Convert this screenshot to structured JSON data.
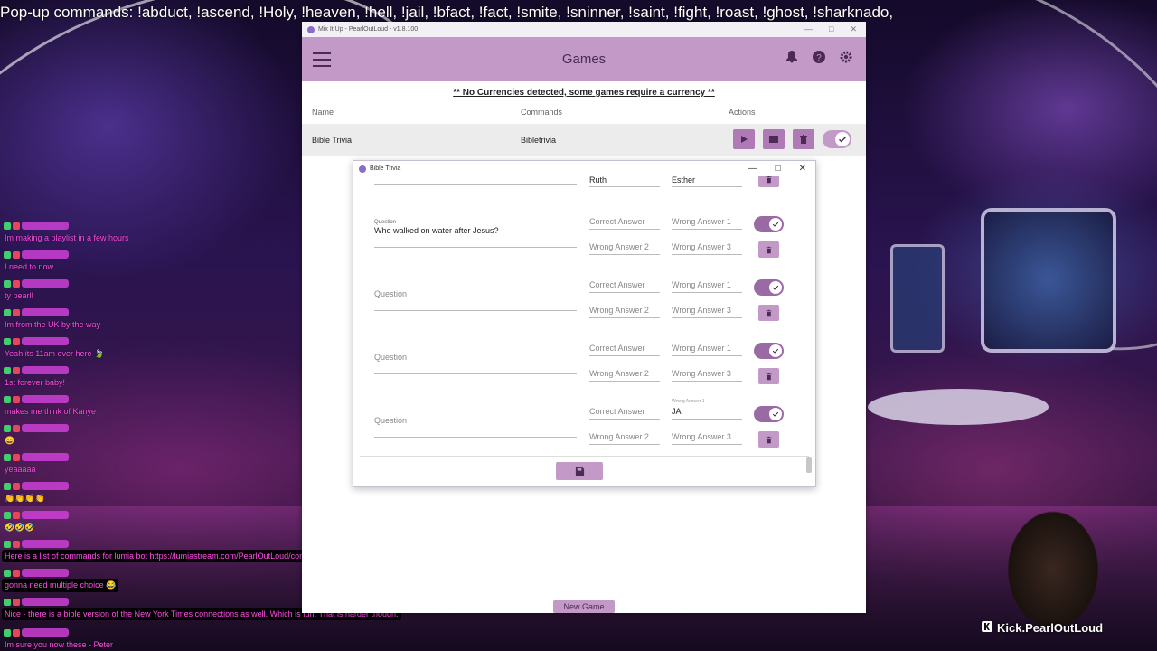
{
  "overlay": {
    "popup_commands": "Pop-up commands: !abduct, !ascend, !Holy, !heaven, !hell,  !jail, !bfact, !fact, !smite, !sninner, !saint, !fight, !roast, !ghost, !sharknado,",
    "brand_handle": "Kick.PearlOutLoud",
    "brand_icon": "kick-icon"
  },
  "chat": [
    {
      "text": "Im making a playlist in a few hours",
      "dark": false
    },
    {
      "text": "I need to now",
      "dark": false
    },
    {
      "text": "ty pearl!",
      "dark": false
    },
    {
      "text": "Im from the UK by the way",
      "dark": false
    },
    {
      "text": "Yeah its 11am over here 🍃",
      "dark": false
    },
    {
      "text": "1st forever baby!",
      "dark": false
    },
    {
      "text": "makes me think of Kanye",
      "dark": false
    },
    {
      "text": "😄",
      "dark": false
    },
    {
      "text": "yeaaaaa",
      "dark": false
    },
    {
      "text": "👏👏👏👏",
      "dark": false
    },
    {
      "text": "🤣🤣🤣",
      "dark": false
    },
    {
      "text": "Here is a list of commands for lumia bot https://lumiastream.com/PearlOutLoud/commands",
      "dark": true
    },
    {
      "text": "gonna need multiple choice 😂",
      "dark": true
    },
    {
      "text": "Nice - there is a bible version of the New York Times connections as well. Which is fun. That is harder though.",
      "dark": true
    },
    {
      "text": "Im sure you now these - Peter",
      "dark": false
    }
  ],
  "app": {
    "window_title": "Mix It Up - PearlOutLoud - v1.8.100",
    "header_title": "Games",
    "currency_notice": "** No Currencies detected, some games require a currency **",
    "columns": {
      "name": "Name",
      "commands": "Commands",
      "actions": "Actions"
    },
    "games": [
      {
        "name": "Bible Trivia",
        "command": "Bibletrivia",
        "enabled": true
      }
    ],
    "new_game_label": "New Game",
    "accent_color": "#c39ac7"
  },
  "dialog": {
    "title": "Bible Trivia",
    "partial_top": {
      "answer_a": "Ruth",
      "answer_b": "Esther"
    },
    "questions": [
      {
        "question_label": "Question",
        "question": "Who walked on water after Jesus?",
        "correct": "",
        "wrong1": "",
        "wrong2": "",
        "wrong3": "",
        "enabled": true
      },
      {
        "question_label": "",
        "question": "",
        "correct": "",
        "wrong1": "",
        "wrong2": "",
        "wrong3": "",
        "enabled": true
      },
      {
        "question_label": "",
        "question": "",
        "correct": "",
        "wrong1": "",
        "wrong2": "",
        "wrong3": "",
        "enabled": true
      },
      {
        "question_label": "",
        "question": "",
        "correct": "",
        "wrong1": "JA",
        "wrong2": "",
        "wrong3": "",
        "enabled": true
      }
    ],
    "placeholders": {
      "question": "Question",
      "correct": "Correct Answer",
      "wrong1": "Wrong Answer 1",
      "wrong2": "Wrong Answer 2",
      "wrong3": "Wrong Answer 3"
    }
  }
}
